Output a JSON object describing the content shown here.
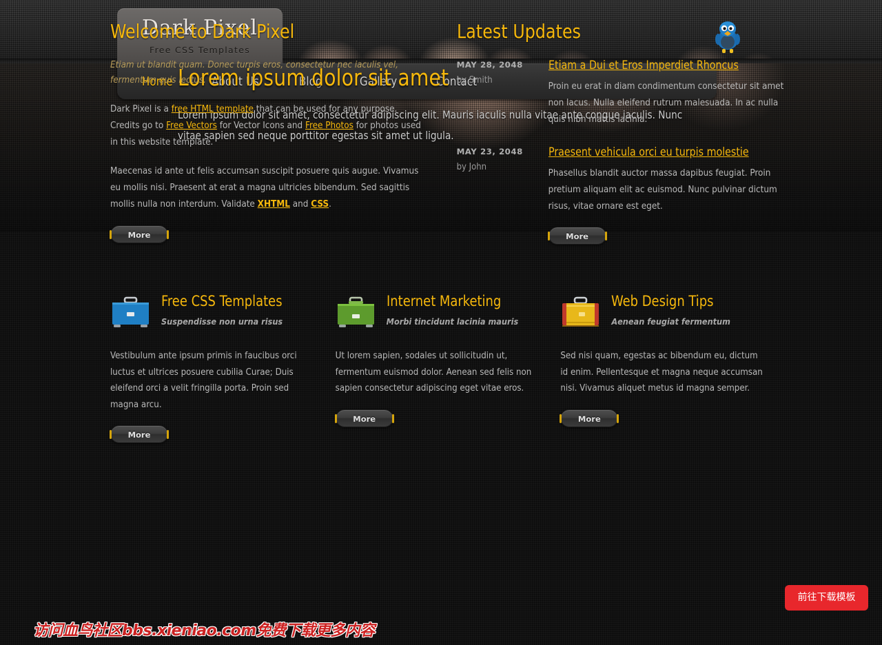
{
  "site": {
    "logo_title": "Dark Pixel",
    "logo_subtitle": "Free CSS Templates",
    "accent_color": "#f6b80c",
    "bird_icon": "twitter-bird-icon"
  },
  "nav": {
    "items": [
      {
        "label": "Home",
        "active": true
      },
      {
        "label": "About Us",
        "active": false
      },
      {
        "label": "Blog",
        "active": false
      },
      {
        "label": "Gallery",
        "active": false
      },
      {
        "label": "Contact",
        "active": false
      }
    ]
  },
  "hero": {
    "title": "Lorem ipsum dolor sit amet",
    "text": "Lorem ipsum dolor sit amet, consectetur adipiscing elit. Mauris iaculis nulla vitae ante congue iaculis. Nunc vitae sapien sed neque porttitor egestas sit amet ut ligula."
  },
  "welcome": {
    "heading": "Welcome to Dark Pixel",
    "intro": "Etiam ut blandit quam. Donec turpis eros, consectetur nec iaculis vel, fermentum quis lectus.",
    "para1_a": "Dark Pixel is a ",
    "para1_link1": "free HTML template",
    "para1_b": " that can be used for any purpose. Credits go to ",
    "para1_link2": "Free Vectors",
    "para1_c": " for Vector Icons and ",
    "para1_link3": "Free Photos",
    "para1_d": " for photos used in this website template.",
    "para2_a": "Maecenas id ante ut felis accumsan suscipit posuere quis augue. Vivamus eu mollis nisi. Praesent at erat a magna ultricies bibendum. Sed sagittis mollis nulla non interdum. Validate ",
    "para2_link1": "XHTML",
    "para2_b": " and ",
    "para2_link2": "CSS",
    "para2_c": ".",
    "more_label": "More"
  },
  "updates": {
    "heading": "Latest Updates",
    "more_label": "More",
    "items": [
      {
        "date": "MAY 28, 2048",
        "author": "by Smith",
        "title": "Etiam a Dui et Eros Imperdiet Rhoncus",
        "text": "Proin eu erat in diam condimentum consectetur sit amet non lacus. Nulla eleifend rutrum malesuada. In ac nulla quis nibh mattis lacinia."
      },
      {
        "date": "MAY 23, 2048",
        "author": "by John",
        "title": "Praesent vehicula orci eu turpis molestie",
        "text": "Phasellus blandit auctor massa dapibus feugiat. Proin pretium aliquam elit ac euismod. Nunc pulvinar dictum risus, vitae ornare est eget."
      }
    ]
  },
  "boxes": [
    {
      "icon": "blue-briefcase-icon",
      "icon_color": "#1f7fc4",
      "title": "Free CSS Templates",
      "subtitle": "Suspendisse non urna risus",
      "text": "Vestibulum ante ipsum primis in faucibus orci luctus et ultrices posuere cubilia Curae; Duis eleifend orci a velit fringilla porta. Proin sed magna arcu.",
      "more_label": "More"
    },
    {
      "icon": "green-briefcase-icon",
      "icon_color": "#5d9b2d",
      "title": "Internet Marketing",
      "subtitle": "Morbi tincidunt lacinia mauris",
      "text": "Ut lorem sapien, sodales ut sollicitudin ut, fermentum euismod dolor. Aenean sed felis non sapien consectetur adipiscing eget vitae eros.",
      "more_label": "More"
    },
    {
      "icon": "yellow-suitcase-icon",
      "icon_color": "#e8b81a",
      "title": "Web Design Tips",
      "subtitle": "Aenean feugiat fermentum",
      "text": "Sed nisi quam, egestas ac bibendum eu, dictum id enim. Pellentesque et magna neque accumsan nisi. Vivamus aliquet metus id magna semper.",
      "more_label": "More"
    }
  ],
  "overlay": {
    "watermark_text": "访问血鸟社区bbs.xieniao.com免费下载更多内容",
    "watermark_color": "#cc2222",
    "cta_label": "前往下载模板",
    "cta_color": "#e8272c"
  }
}
